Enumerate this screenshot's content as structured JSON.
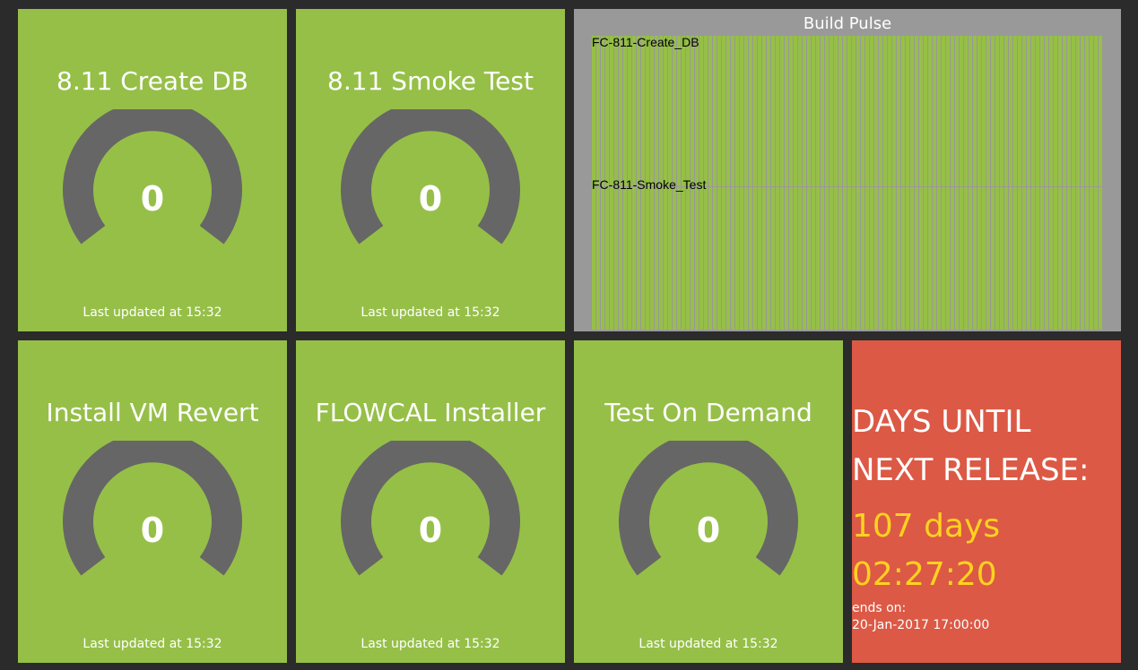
{
  "widgets": [
    {
      "title": "8.11 Create DB",
      "value": "0",
      "updated": "Last updated at 15:32"
    },
    {
      "title": "8.11 Smoke Test",
      "value": "0",
      "updated": "Last updated at 15:32"
    },
    {
      "title": "Install VM Revert",
      "value": "0",
      "updated": "Last updated at 15:32"
    },
    {
      "title": "FLOWCAL Installer",
      "value": "0",
      "updated": "Last updated at 15:32"
    },
    {
      "title": "Test On Demand",
      "value": "0",
      "updated": "Last updated at 15:32"
    }
  ],
  "pulse": {
    "title": "Build Pulse",
    "rows": [
      {
        "label": "FC-811-Create_DB"
      },
      {
        "label": "FC-811-Smoke_Test"
      }
    ],
    "bar_color": "#96bf48",
    "background": "#999999"
  },
  "countdown": {
    "title_line1": "DAYS UNTIL",
    "title_line2": "NEXT RELEASE:",
    "days": "107 days",
    "time": "02:27:20",
    "ends_label": "ends on:",
    "ends_date": "20-Jan-2017 17:00:00"
  },
  "colors": {
    "tile_green": "#96bf48",
    "gauge_gray": "#666666",
    "countdown_red": "#dc5945",
    "countdown_yellow": "#ffd21f",
    "page_background": "#2b2b2b"
  }
}
